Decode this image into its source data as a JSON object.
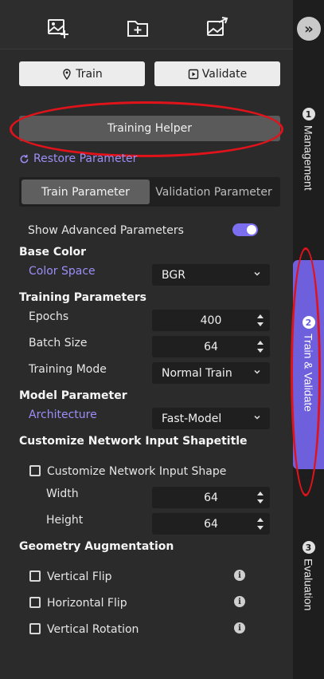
{
  "toolbar": {
    "icons": [
      "add-image-icon",
      "add-folder-icon",
      "export-image-icon"
    ],
    "collapse_icon": "double-chevron-right-icon"
  },
  "modes": [
    {
      "label": "Train",
      "icon": "pin-icon"
    },
    {
      "label": "Validate",
      "icon": "play-box-icon"
    }
  ],
  "training_helper": {
    "label": "Training Helper"
  },
  "restore": {
    "label": "Restore Parameter",
    "icon": "refresh-icon"
  },
  "param_tabs": [
    {
      "label": "Train Parameter",
      "active": true
    },
    {
      "label": "Validation Parameter",
      "active": false
    }
  ],
  "advanced": {
    "label": "Show Advanced Parameters",
    "enabled": true
  },
  "base_color": {
    "title": "Base Color",
    "color_space_label": "Color Space",
    "color_space_value": "BGR"
  },
  "training_params": {
    "title": "Training Parameters",
    "epochs_label": "Epochs",
    "epochs_value": "400",
    "batch_label": "Batch Size",
    "batch_value": "64",
    "mode_label": "Training Mode",
    "mode_value": "Normal Train"
  },
  "model_param": {
    "title": "Model Parameter",
    "arch_label": "Architecture",
    "arch_value": "Fast-Model"
  },
  "network_input": {
    "title": "Customize Network Input Shapetitle",
    "checkbox_label": "Customize Network Input Shape",
    "checked": false,
    "width_label": "Width",
    "width_value": "64",
    "height_label": "Height",
    "height_value": "64"
  },
  "geometry": {
    "title": "Geometry Augmentation",
    "options": [
      {
        "label": "Vertical Flip",
        "checked": false
      },
      {
        "label": "Horizontal Flip",
        "checked": false
      },
      {
        "label": "Vertical Rotation",
        "checked": false
      }
    ]
  },
  "rail": [
    {
      "num": "1",
      "label": "Management",
      "active": false
    },
    {
      "num": "2",
      "label": "Train & Validate",
      "active": true
    },
    {
      "num": "3",
      "label": "Evaluation",
      "active": false
    }
  ],
  "colors": {
    "accent": "#6e5fdc",
    "link": "#9c8ef7",
    "annotation": "#e0131a"
  }
}
